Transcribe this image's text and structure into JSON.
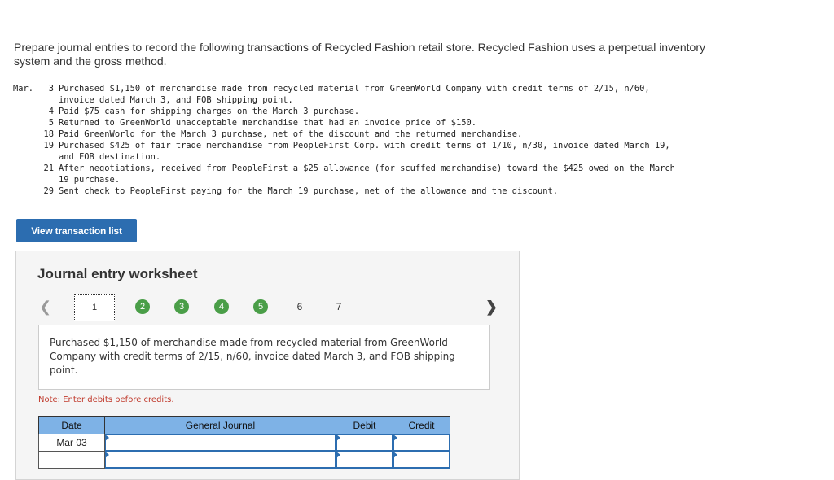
{
  "instructions": "Prepare journal entries to record the following transactions of Recycled Fashion retail store. Recycled Fashion uses a perpetual inventory system and the gross method.",
  "transactions": {
    "month": "Mar.",
    "items": [
      {
        "day": "3",
        "text": "Purchased $1,150 of merchandise made from recycled material from GreenWorld Company with credit terms of 2/15, n/60,\ninvoice dated March 3, and FOB shipping point."
      },
      {
        "day": "4",
        "text": "Paid $75 cash for shipping charges on the March 3 purchase."
      },
      {
        "day": "5",
        "text": "Returned to GreenWorld unacceptable merchandise that had an invoice price of $150."
      },
      {
        "day": "18",
        "text": "Paid GreenWorld for the March 3 purchase, net of the discount and the returned merchandise."
      },
      {
        "day": "19",
        "text": "Purchased $425 of fair trade merchandise from PeopleFirst Corp. with credit terms of 1/10, n/30, invoice dated March 19,\nand FOB destination."
      },
      {
        "day": "21",
        "text": "After negotiations, received from PeopleFirst a $25 allowance (for scuffed merchandise) toward the $425 owed on the March\n19 purchase."
      },
      {
        "day": "29",
        "text": "Sent check to PeopleFirst paying for the March 19 purchase, net of the allowance and the discount."
      }
    ]
  },
  "view_button_label": "View transaction list",
  "worksheet": {
    "title": "Journal entry worksheet",
    "prev_icon": "chevron-left-icon",
    "next_icon": "chevron-right-icon",
    "steps": [
      {
        "label": "1",
        "state": "active"
      },
      {
        "label": "2",
        "state": "done"
      },
      {
        "label": "3",
        "state": "done"
      },
      {
        "label": "4",
        "state": "done"
      },
      {
        "label": "5",
        "state": "done"
      },
      {
        "label": "6",
        "state": "plain"
      },
      {
        "label": "7",
        "state": "plain"
      }
    ],
    "description": "Purchased $1,150 of merchandise made from recycled material from GreenWorld Company with credit terms of 2/15, n/60, invoice dated March 3, and FOB shipping point.",
    "note": "Note: Enter debits before credits.",
    "table": {
      "headers": [
        "Date",
        "General Journal",
        "Debit",
        "Credit"
      ],
      "rows": [
        {
          "date": "Mar 03",
          "account": "",
          "debit": "",
          "credit": ""
        },
        {
          "date": "",
          "account": "",
          "debit": "",
          "credit": ""
        }
      ]
    }
  },
  "colors": {
    "button": "#2c6db0",
    "step_done": "#4a9e48",
    "table_header": "#7eb2e6",
    "note": "#c0392b"
  }
}
